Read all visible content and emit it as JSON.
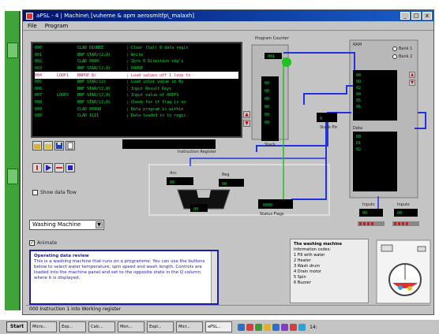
{
  "window": {
    "title": "aPSL - 4 | Machine\\ [vuheme & apm aerosmitfp\\_malaxh]",
    "menus": [
      "File",
      "Program"
    ],
    "controls": [
      "_",
      "□",
      "x"
    ]
  },
  "code_listing": [
    {
      "addr": "000",
      "label": "",
      "instr": "CLAD 01UNEE",
      "comment": "; Clear (Sal) 0 data regis"
    },
    {
      "addr": "001",
      "label": "",
      "instr": "BNF STAR/(2,0)",
      "comment": "; Write"
    },
    {
      "addr": "002",
      "label": "",
      "instr": "CLAD 0999",
      "comment": "; Zero 0 Direction reg's"
    },
    {
      "addr": "003",
      "label": "",
      "instr": "BNF STAR/(2,0)",
      "comment": "; PAUSE"
    },
    {
      "addr": "004",
      "label": "LOOP1",
      "instr": "BNPOP 8/",
      "comment": "; Load values off 1 loop to"
    },
    {
      "addr": "005",
      "label": "",
      "instr": "BNF STAR/(2)",
      "comment": "; Load color value in Bu"
    },
    {
      "addr": "006",
      "label": "",
      "instr": "BNF STAR/(2,0)",
      "comment": "; Input Result Keys"
    },
    {
      "addr": "007",
      "label": "LOOP2",
      "instr": "BNF STAR/(2,0)",
      "comment": "; Input value of 00EPS"
    },
    {
      "addr": "008",
      "label": "",
      "instr": "BNF STAR/(2,0)",
      "comment": "; Check for if flag is on"
    },
    {
      "addr": "009",
      "label": "",
      "instr": "CLAD 00808",
      "comment": "; Data program is within"
    },
    {
      "addr": "010",
      "label": "",
      "instr": "CLAD 1221",
      "comment": "; Data loaded in to regis"
    }
  ],
  "labels": {
    "instruction_register": "Instruction\nRegister",
    "program_counter": "Program\nCounter",
    "stack": "Stack",
    "stack_ptr": "Stack\nPtr",
    "acc": "Acc",
    "reg": "Reg",
    "status_flags": "Status Flags",
    "inputs_a": "Inputs",
    "inputs_b": "Inputs",
    "rom": "RAM",
    "data_label": "Data",
    "bank1": "Bank 1",
    "bank2": "Bank 2",
    "show_data_flow": "Show data flow",
    "animate": "Animate",
    "outputs": "Outputs"
  },
  "select": {
    "value": "Washing Machine"
  },
  "info": {
    "heading": "Operating data review",
    "body": "This is a washing machine that runs on a programme. You can use the buttons below to select water temperature, spin speed and wash length. Controls are loaded into the machine panel and set to the opposite state in the Q column where it is displayed."
  },
  "legend": {
    "title": "The washing machine",
    "subtitle": "Information codes:",
    "items": [
      "1  Fill with water",
      "2  Heater",
      "3  Wash drum",
      "4  Drain motor",
      "5  Spin",
      "6  Buzzer"
    ]
  },
  "status_text": "000   Instruction 1 into Working register",
  "taskbar": {
    "start": "Start",
    "tasks": [
      "Micro...",
      "Exp...",
      "Calc...",
      "Mon...",
      "Expl...",
      "Micr...",
      "aPSL..."
    ],
    "clock": "14:"
  },
  "colors": {
    "lcd_green": "#00e63c",
    "title_blue": "#00146e",
    "wire_blue": "#2233dd",
    "wire_green": "#22c022"
  }
}
